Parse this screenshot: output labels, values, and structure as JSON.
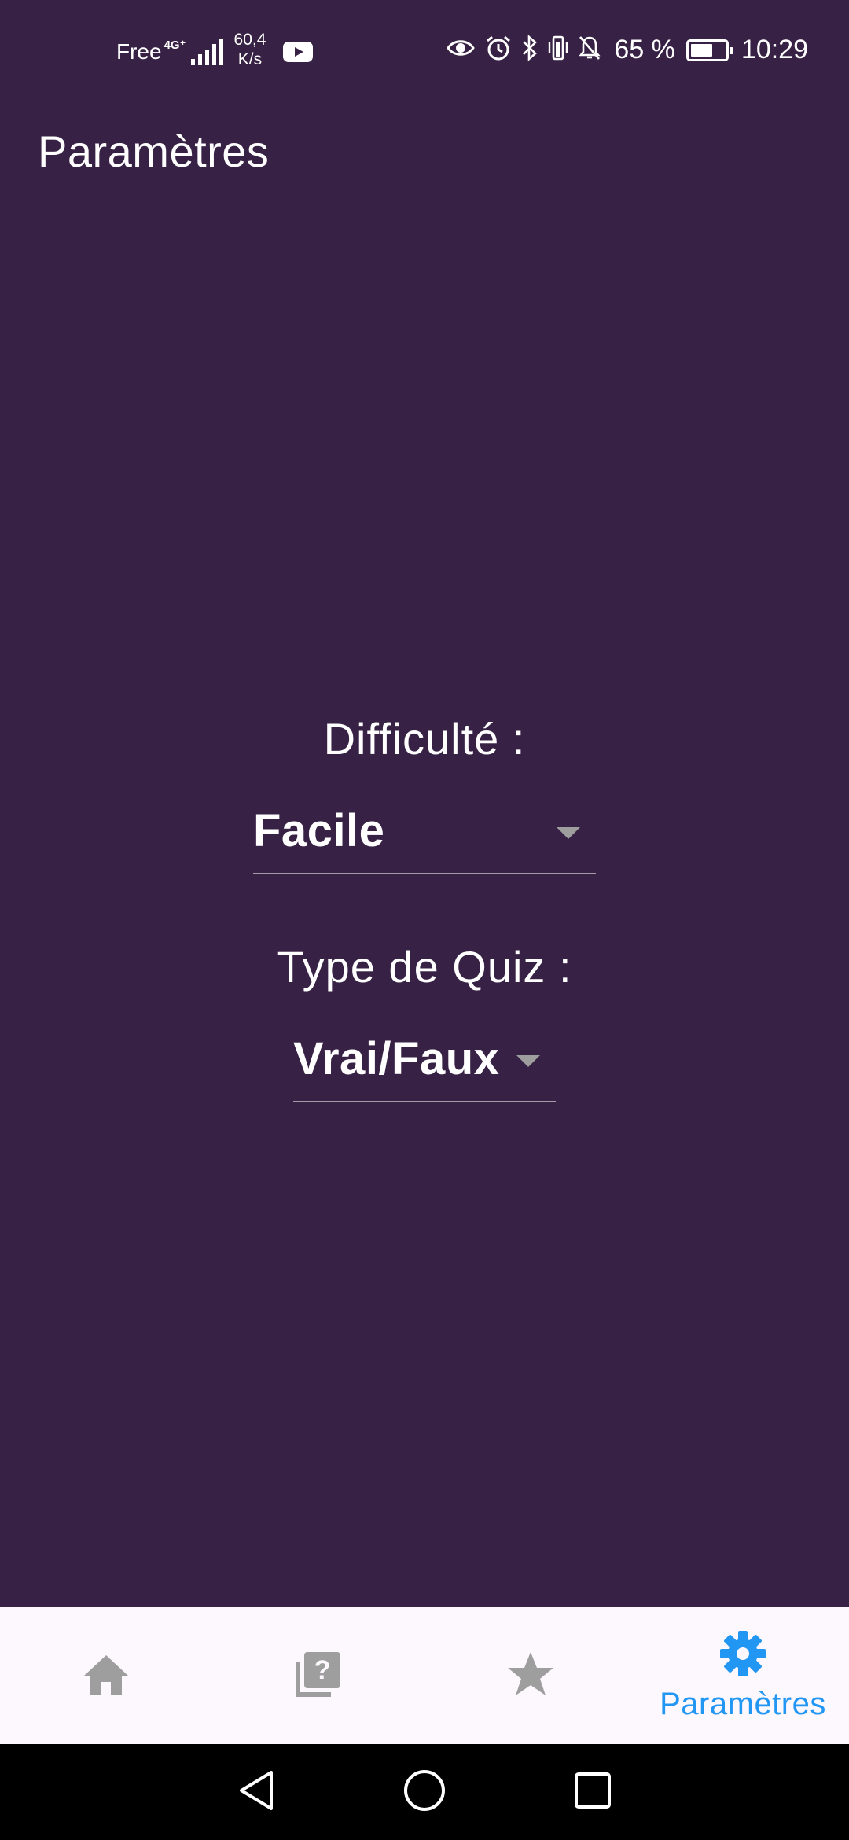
{
  "status_bar": {
    "carrier": "Free",
    "network_type": "4G⁺",
    "speed_value": "60,4",
    "speed_unit": "K/s",
    "battery_percent": "65 %",
    "battery_level": 0.65,
    "time": "10:29",
    "left_icons": [
      "signal-icon",
      "youtube-icon"
    ],
    "right_icons": [
      "eye-icon",
      "alarm-icon",
      "bluetooth-icon",
      "vibrate-icon",
      "notifications-off-icon",
      "battery-icon"
    ]
  },
  "header": {
    "title": "Paramètres"
  },
  "settings": {
    "difficulty": {
      "label": "Difficulté :",
      "selected": "Facile"
    },
    "quiz_type": {
      "label": "Type de Quiz :",
      "selected": "Vrai/Faux"
    }
  },
  "bottom_nav": {
    "items": [
      {
        "icon": "home-icon",
        "label": "",
        "active": false
      },
      {
        "icon": "quiz-icon",
        "label": "",
        "active": false
      },
      {
        "icon": "star-icon",
        "label": "",
        "active": false
      },
      {
        "icon": "settings-gear-icon",
        "label": "Paramètres",
        "active": true
      }
    ],
    "active_color": "#2196F3",
    "inactive_color": "#9E9E9E"
  },
  "system_nav": {
    "buttons": [
      "back-icon",
      "home-circle-icon",
      "recents-icon"
    ]
  },
  "colors": {
    "background": "#372144",
    "nav_background": "#FDF7FE",
    "text": "#FFFFFF"
  }
}
